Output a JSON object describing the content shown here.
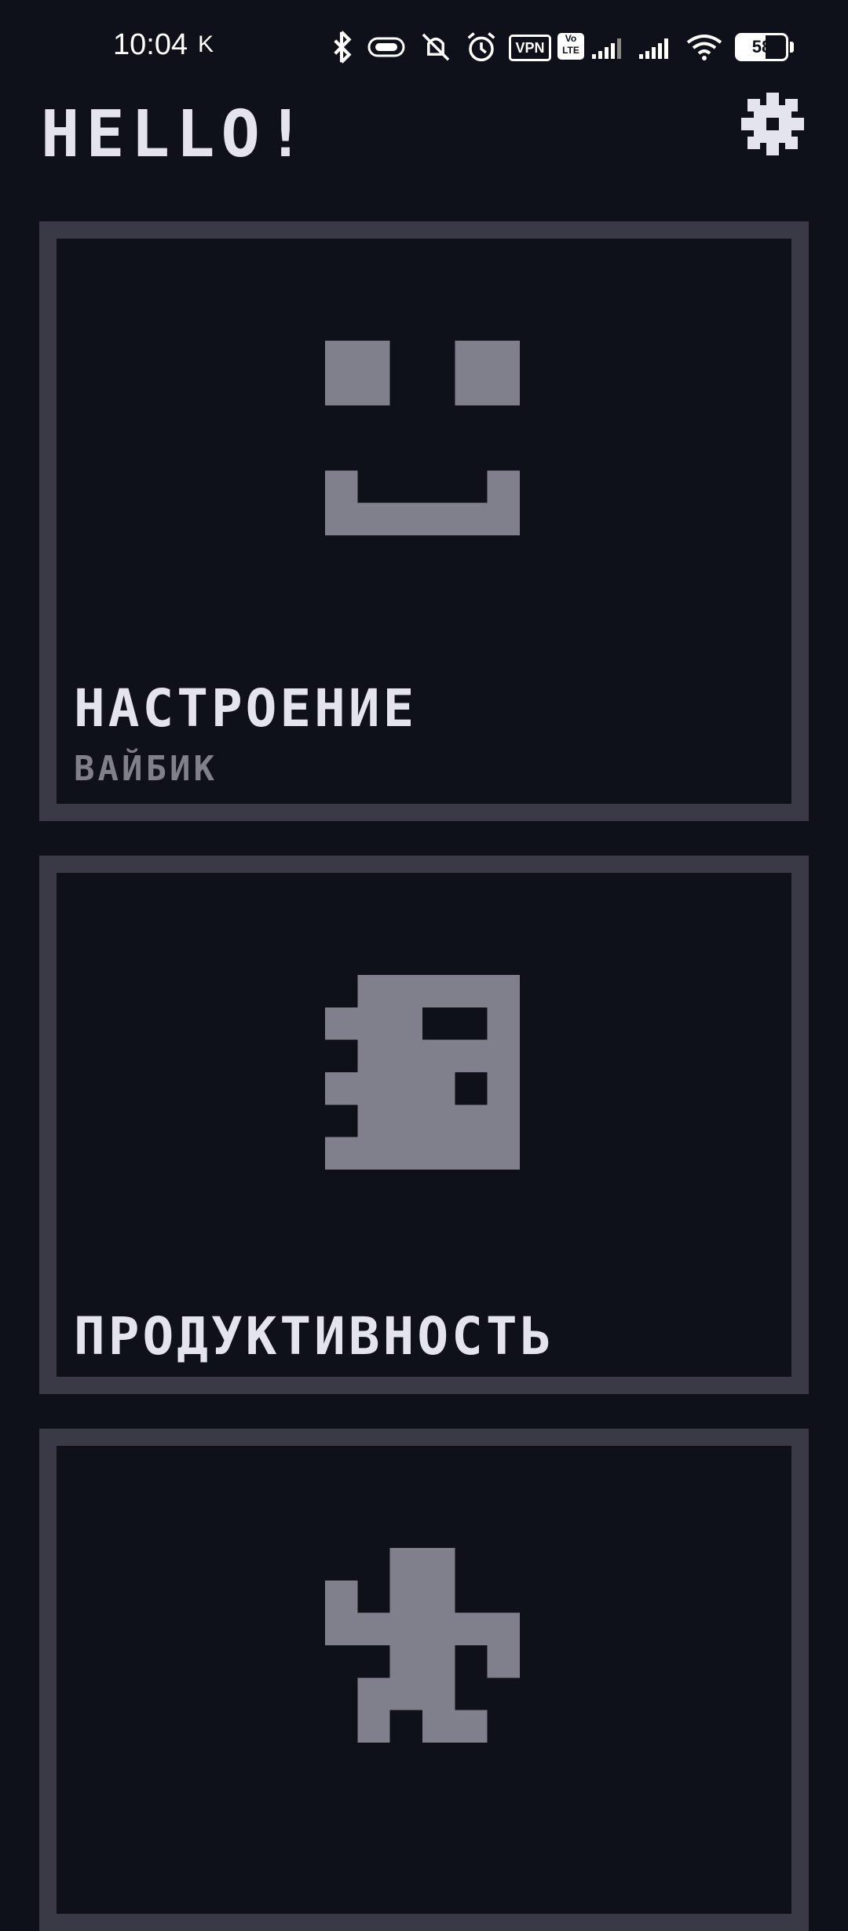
{
  "status_bar": {
    "time": "10:04",
    "net_indicator": "K",
    "vpn_label": "VPN",
    "volte_label": "Vo LTE",
    "battery_percent": "58",
    "icons": [
      "bluetooth-icon",
      "battery-saver-icon",
      "mute-icon",
      "alarm-icon",
      "vpn-icon",
      "volte-icon",
      "signal-icon",
      "signal-icon",
      "wifi-icon",
      "battery-icon"
    ]
  },
  "header": {
    "greeting": "HELLO!",
    "settings_icon": "gear-icon"
  },
  "cards": [
    {
      "title": "НАСТРОЕНИЕ",
      "subtitle": "ВАЙБИК",
      "icon": "smiley-face-icon"
    },
    {
      "title": "ПРОДУКТИВНОСТЬ",
      "icon": "notebook-icon"
    },
    {
      "title": "",
      "icon": "running-figure-icon"
    }
  ],
  "colors": {
    "background": "#0f111a",
    "card_border": "#3a3a46",
    "pixel_icon": "#7f808b",
    "text_primary": "#e4e4ef",
    "text_secondary": "#80808a"
  }
}
